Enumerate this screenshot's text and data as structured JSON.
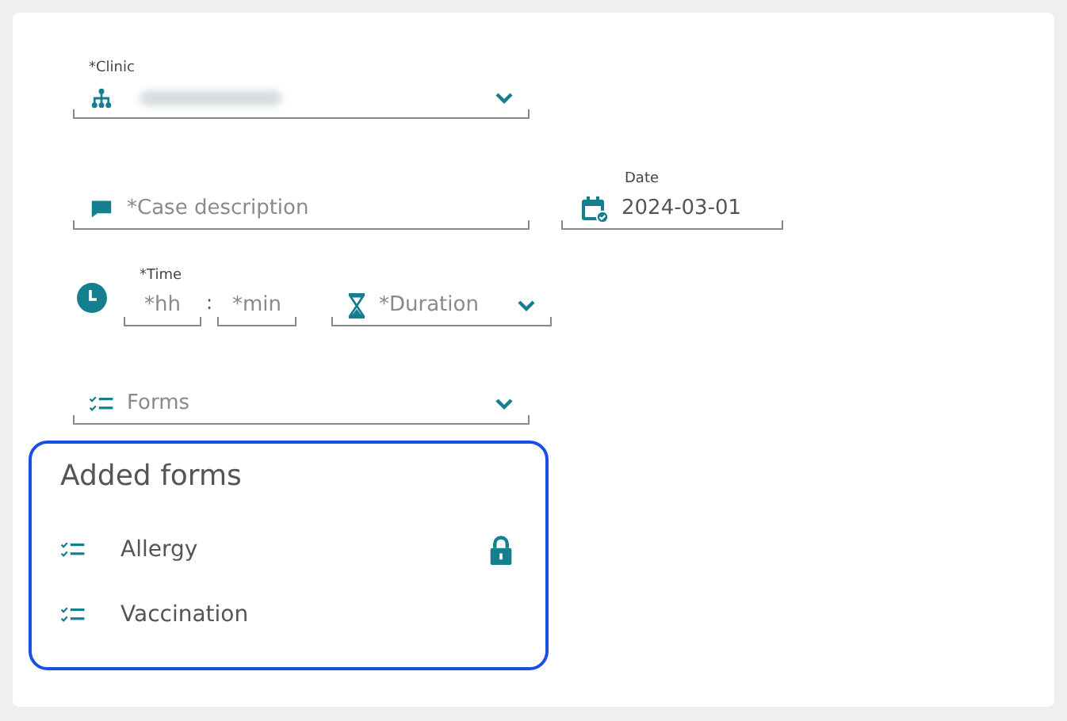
{
  "clinic": {
    "label": "*Clinic",
    "value_redacted": true
  },
  "case_description": {
    "placeholder": "*Case description"
  },
  "date": {
    "label": "Date",
    "value": "2024-03-01"
  },
  "time": {
    "label": "*Time",
    "hours_placeholder": "*hh",
    "separator": ":",
    "minutes_placeholder": "*min"
  },
  "duration": {
    "placeholder": "*Duration"
  },
  "forms_select": {
    "placeholder": "Forms"
  },
  "added_forms": {
    "title": "Added forms",
    "items": [
      {
        "name": "Allergy",
        "locked": true
      },
      {
        "name": "Vaccination",
        "locked": false
      }
    ]
  }
}
